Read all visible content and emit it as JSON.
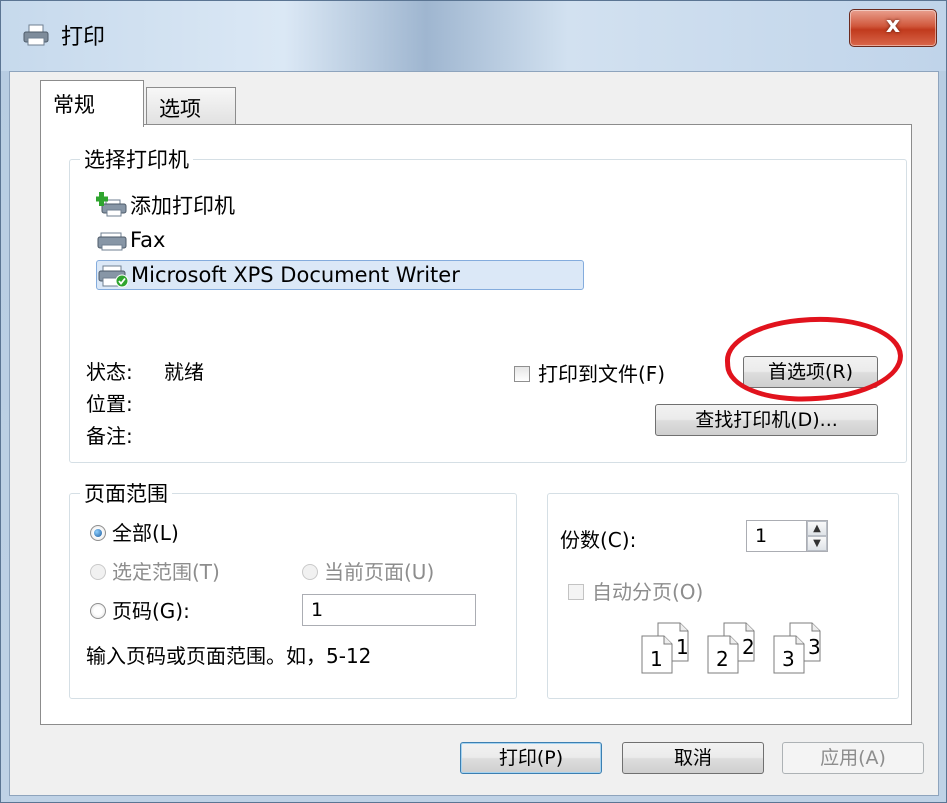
{
  "window": {
    "title": "打印",
    "close_label": "x"
  },
  "tabs": [
    {
      "label": "常规",
      "active": true
    },
    {
      "label": "选项",
      "active": false
    }
  ],
  "printer_group": {
    "title": "选择打印机",
    "printers": [
      {
        "name": "添加打印机",
        "icon": "add-printer-icon",
        "selected": false
      },
      {
        "name": "Fax",
        "icon": "fax-printer-icon",
        "selected": false
      },
      {
        "name": "Microsoft XPS Document Writer",
        "icon": "default-printer-icon",
        "selected": true
      }
    ],
    "status_label": "状态:",
    "status_value": "就绪",
    "location_label": "位置:",
    "comment_label": "备注:",
    "print_to_file_label": "打印到文件(F)",
    "print_to_file_checked": false,
    "preferences_button": "首选项(R)",
    "find_printer_button": "查找打印机(D)..."
  },
  "page_range": {
    "title": "页面范围",
    "all_label": "全部(L)",
    "selection_label": "选定范围(T)",
    "current_page_label": "当前页面(U)",
    "pages_label": "页码(G):",
    "pages_value": "1",
    "hint": "输入页码或页面范围。如，5-12",
    "selected_option": "all"
  },
  "copies": {
    "label": "份数(C):",
    "value": "1",
    "collate_label": "自动分页(O)",
    "collate_enabled": false,
    "collate_icons": [
      "1",
      "1",
      "2",
      "2",
      "3",
      "3"
    ]
  },
  "buttons": {
    "print": "打印(P)",
    "cancel": "取消",
    "apply": "应用(A)"
  },
  "colors": {
    "accent": "#3c7fb1",
    "annotation": "#e1131d",
    "selection": "#dbe8f7"
  }
}
